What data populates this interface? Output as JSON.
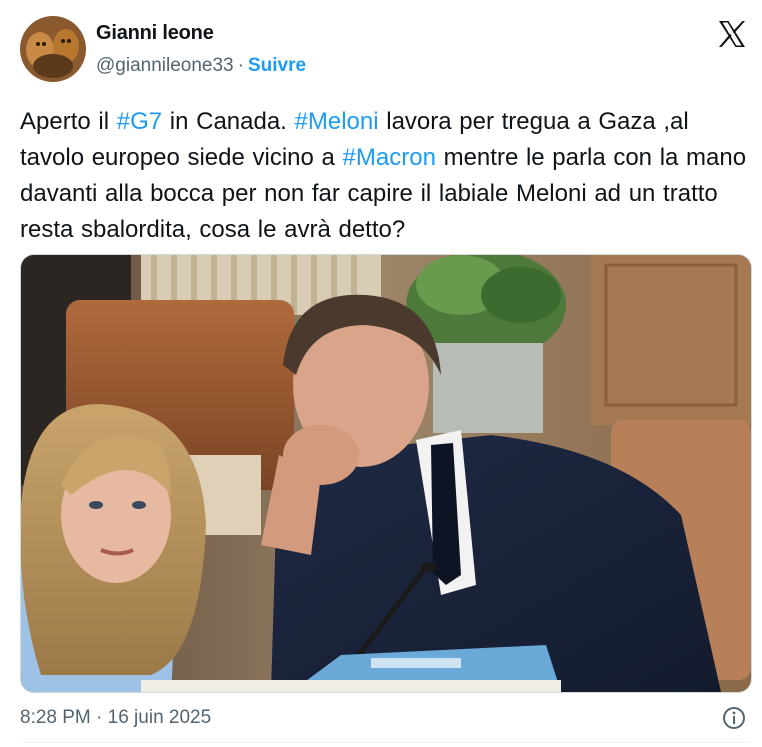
{
  "author": {
    "name": "Gianni leone",
    "handle": "@giannileone33",
    "separator": "·",
    "follow_label": "Suivre",
    "avatar_icon": "profile-avatar"
  },
  "platform_icon": "x-logo",
  "tweet": {
    "text_parts": [
      {
        "text": "Aperto il ",
        "type": "text"
      },
      {
        "text": "#G7",
        "type": "hashtag"
      },
      {
        "text": " in Canada. ",
        "type": "text"
      },
      {
        "text": "#Meloni",
        "type": "hashtag"
      },
      {
        "text": " lavora per tregua a Gaza ,al tavolo europeo siede vicino a ",
        "type": "text"
      },
      {
        "text": "#Macron",
        "type": "hashtag"
      },
      {
        "text": " mentre le parla con la mano davanti alla bocca per non far capire il labiale Meloni ad un tratto resta sbalordita, cosa le avrà detto?",
        "type": "text"
      }
    ]
  },
  "media": {
    "kind": "photo"
  },
  "footer": {
    "timestamp": "8:28 PM · 16 juin 2025",
    "info_icon": "info-icon"
  },
  "colors": {
    "link": "#1d9bf0",
    "text": "#0f1419",
    "muted": "#536471",
    "border": "#cfd9de"
  }
}
